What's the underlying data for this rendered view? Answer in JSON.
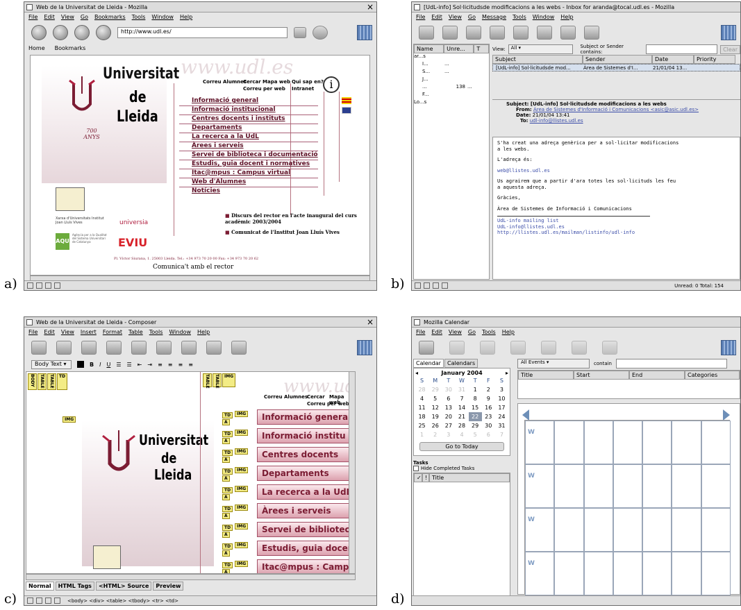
{
  "labels": {
    "a": "a)",
    "b": "b)",
    "c": "c)",
    "d": "d)"
  },
  "common": {
    "close": "×"
  },
  "winA": {
    "title": "Web de la Universitat de Lleida - Mozilla",
    "menu": [
      "File",
      "Edit",
      "View",
      "Go",
      "Bookmarks",
      "Tools",
      "Window",
      "Help"
    ],
    "url": "http://www.udl.es/",
    "personal": [
      "Home",
      "Bookmarks"
    ],
    "logo": [
      "Universitat",
      "de",
      "Lleida"
    ],
    "years": "700 ANYS",
    "watermark": "www.udl.es",
    "topnav": [
      "Correu Alumnes",
      "Cercar",
      "Mapa web",
      "Qui sap en?",
      "Correu per web",
      "Intranet"
    ],
    "info": "i",
    "nav": [
      "Informació general",
      "Informació institucional",
      "Centres docents i instituts",
      "Departaments",
      "La recerca a la UdL",
      "Àrees i serveis",
      "Servei de biblioteca i documentació",
      "Estudis, guia docent i normatives",
      "Itac@mpus : Campus virtual",
      "Web d'Alumnes",
      "Notícies"
    ],
    "news": [
      "Discurs del rector en l'acte inaugural del curs acadèmic 2003/2004",
      "Comunicat de l'Institut Joan Lluís Vives"
    ],
    "sponsors": [
      "Xarxa d'Universitats Institut Joan Lluís Vives",
      "universia",
      "AQU",
      "Agència per a la Qualitat del Sistema Universitari de Catalunya",
      "EVIU"
    ],
    "footer_addr": "Pl. Víctor Siurana, 1. 25003 Lleida. Tel.: +34 973 70 20 00 Fax: +34 973 70 20 62",
    "footer": "Comunica't amb el rector"
  },
  "winB": {
    "title": "[UdL-info] Sol·licitudsde modificacions a les webs - Inbox for aranda@tocal.udl.es - Mozilla",
    "menu": [
      "File",
      "Edit",
      "View",
      "Go",
      "Message",
      "Tools",
      "Window",
      "Help"
    ],
    "folder_cols": [
      "Name",
      "Unre...",
      "T"
    ],
    "folders": [
      {
        "name": "ar...s",
        "u": "",
        "t": ""
      },
      {
        "name": "I...",
        "u": "...",
        "t": ""
      },
      {
        "name": "S...",
        "u": "...",
        "t": ""
      },
      {
        "name": "J...",
        "u": "",
        "t": ""
      },
      {
        "name": "...",
        "u": "138",
        "t": "..."
      },
      {
        "name": "F...",
        "u": "",
        "t": ""
      },
      {
        "name": "Lo...s",
        "u": "",
        "t": ""
      }
    ],
    "view_label": "View:",
    "view_value": "All",
    "search_label": "Subject or Sender contains:",
    "clear": "Clear",
    "cols": [
      "Subject",
      "Sender",
      "Date",
      "Priority"
    ],
    "row": {
      "subject": "[UdL-info] Sol·licitudsde mod...",
      "sender": "Àrea de Sistemes d'I...",
      "date": "21/01/04 13..."
    },
    "hdr": {
      "subject_l": "Subject:",
      "subject": "[UdL-info] Sol·licitudsde modificacions a les webs",
      "from_l": "From:",
      "from": "Àrea de Sistemes d'Informació i Comunicacions <asic@asic.udl.es>",
      "date_l": "Date:",
      "date": "21/01/04 13:41",
      "to_l": "To:",
      "to": "udl-info@llistes.udl.es"
    },
    "body": [
      "S'ha creat una adreça genèrica per a sol·licitar modificacions",
      "a les webs.",
      "",
      "L'adreça és:",
      "",
      "web@llistes.udl.es",
      "",
      "Us agrairem que a partir d'ara totes les sol·licituds les feu",
      "a aquesta adreça.",
      "",
      "Gràcies,",
      "",
      "Àrea de Sistemes de Informació i Comunicacions"
    ],
    "sig": [
      "UdL-info mailing list",
      "UdL-info@llistes.udl.es",
      "http://llistes.udl.es/mailman/listinfo/udl-info"
    ],
    "status": "Unread: 0  Total: 154"
  },
  "winC": {
    "title": "Web de la Universitat de Lleida - Composer",
    "menu": [
      "File",
      "Edit",
      "View",
      "Insert",
      "Format",
      "Table",
      "Tools",
      "Window",
      "Help"
    ],
    "style": "Body Text",
    "tags_left": [
      "BODY",
      "TABLE",
      "TABLE",
      "TD"
    ],
    "img": "IMG",
    "td": "TD",
    "a": "A",
    "logo": [
      "Universitat",
      "de",
      "Lleida"
    ],
    "watermark": "www.udl.es",
    "topnav": [
      "Correu Alumnes",
      "Cercar",
      "Mapa web",
      "Correu per web"
    ],
    "nav": [
      "Informació general",
      "Informació institu",
      "Centres docents",
      "Departaments",
      "La recerca a la UdL",
      "Àrees i serveis",
      "Servei de biblioteca",
      "Estudis, guia docent i n",
      "Itac@mpus : Campu"
    ],
    "tabs": [
      "Normal",
      "HTML Tags",
      "<HTML> Source",
      "Preview"
    ],
    "status": "<body> <div> <table> <tbody> <tr> <td>"
  },
  "winD": {
    "title": "Mozilla Calendar",
    "menu": [
      "File",
      "Edit",
      "View",
      "Go",
      "Tools",
      "Help"
    ],
    "tabs": [
      "Calendar",
      "Calendars"
    ],
    "month": "January 2004",
    "dow": [
      "S",
      "M",
      "T",
      "W",
      "T",
      "F",
      "S"
    ],
    "weeks": [
      [
        "28",
        "29",
        "30",
        "31",
        "1",
        "2",
        "3"
      ],
      [
        "4",
        "5",
        "6",
        "7",
        "8",
        "9",
        "10"
      ],
      [
        "11",
        "12",
        "13",
        "14",
        "15",
        "16",
        "17"
      ],
      [
        "18",
        "19",
        "20",
        "21",
        "22",
        "23",
        "24"
      ],
      [
        "25",
        "26",
        "27",
        "28",
        "29",
        "30",
        "31"
      ],
      [
        "1",
        "2",
        "3",
        "4",
        "5",
        "6",
        "7"
      ]
    ],
    "today": "Go to Today",
    "tasks": "Tasks",
    "hide": "Hide Completed Tasks",
    "task_cols": [
      "!",
      "Title"
    ],
    "filter": "All Events",
    "contain": "contain",
    "ev_cols": [
      "Title",
      "Start",
      "End",
      "Categories"
    ],
    "week": "W"
  }
}
